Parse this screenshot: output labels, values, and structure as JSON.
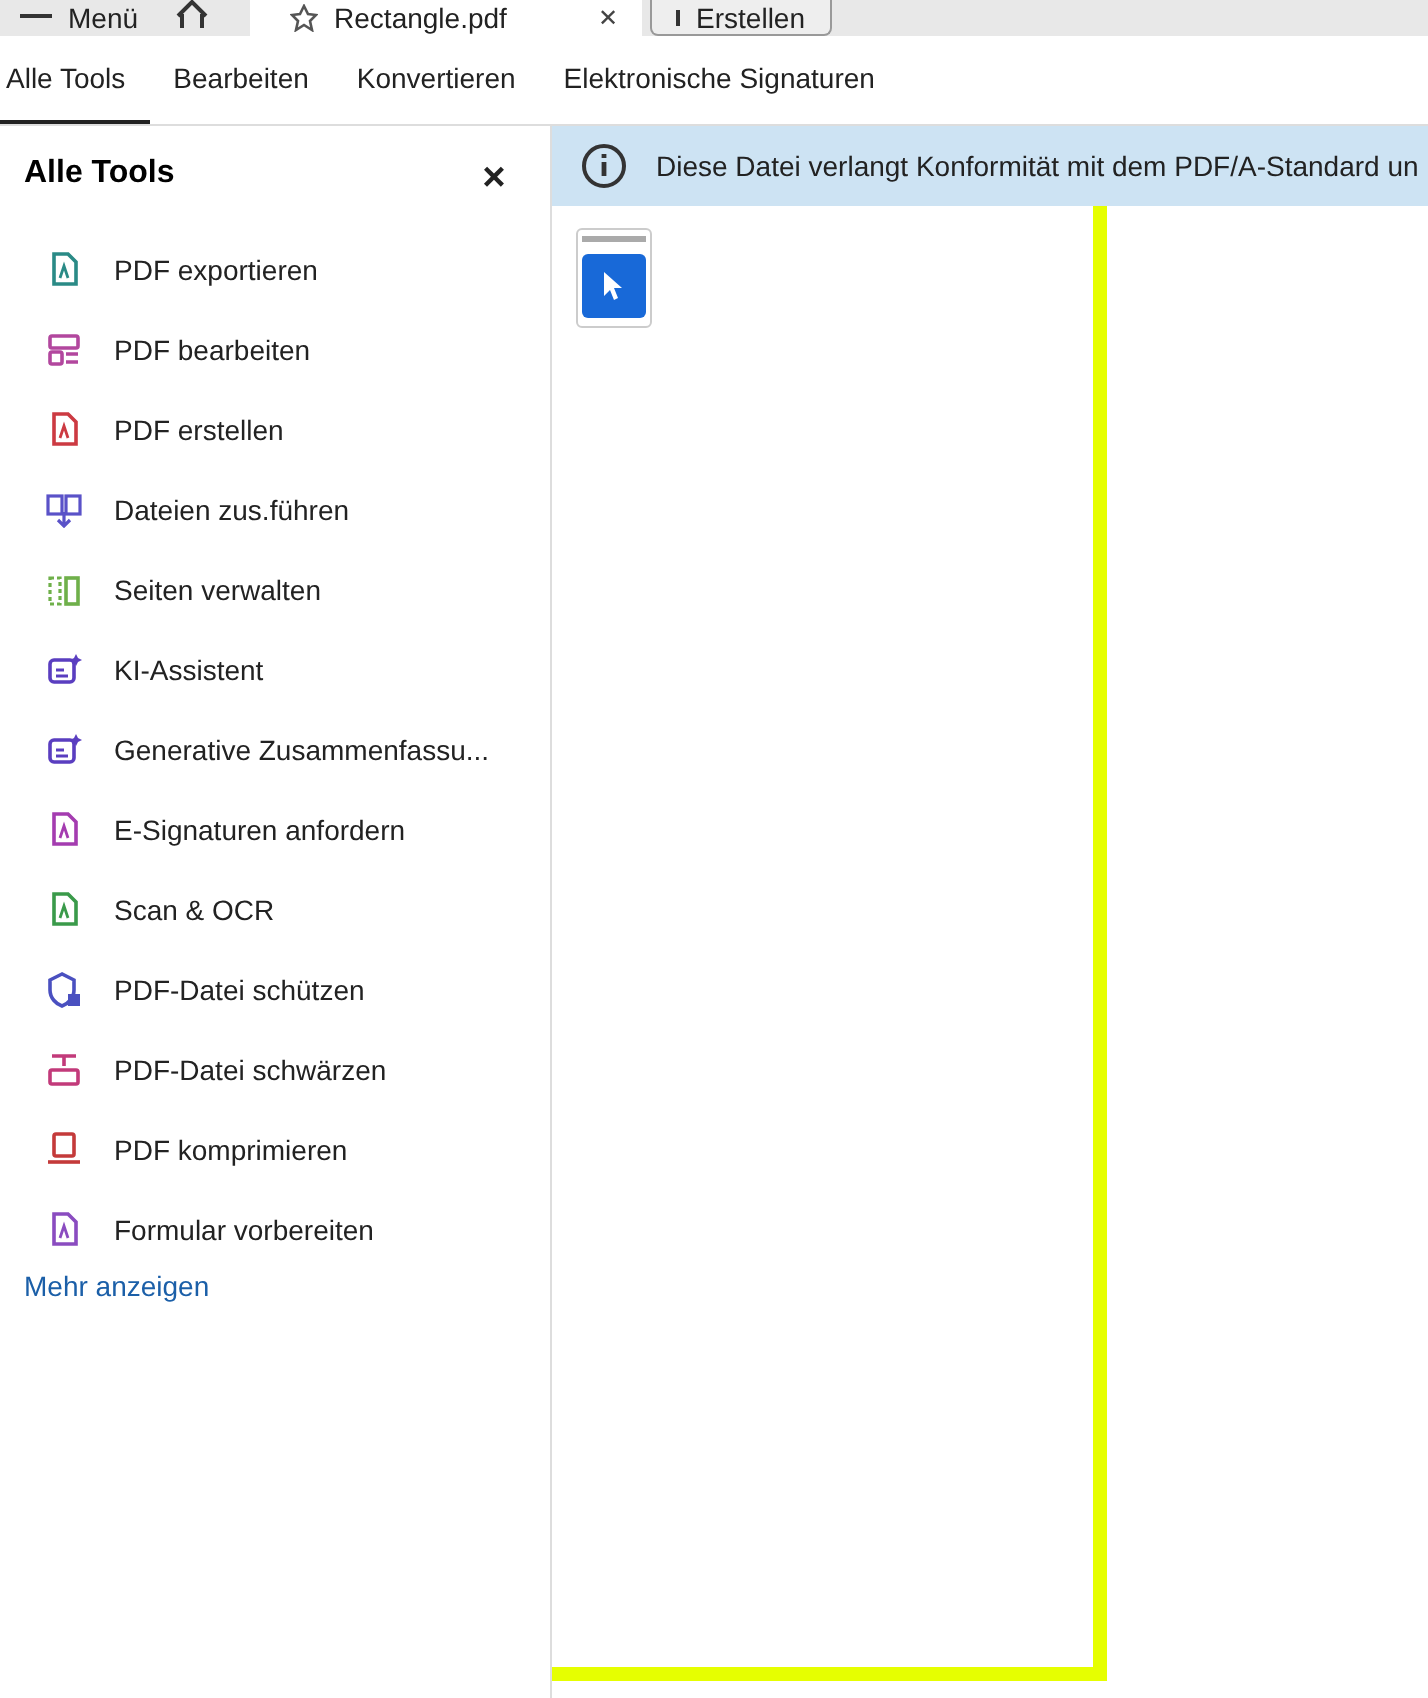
{
  "app_tabs": [
    {
      "label": "Menü",
      "kind": "menu",
      "selected": false
    },
    {
      "kind": "home",
      "selected": false
    },
    {
      "label": "Rectangle.pdf",
      "kind": "file",
      "selected": true,
      "close": "✕"
    },
    {
      "label": "Erstellen",
      "kind": "create",
      "selected": false
    }
  ],
  "nav_tabs": [
    {
      "label": "Alle Tools",
      "selected": true
    },
    {
      "label": "Bearbeiten",
      "selected": false
    },
    {
      "label": "Konvertieren",
      "selected": false
    },
    {
      "label": "Elektronische Signaturen",
      "selected": false
    }
  ],
  "sidebar": {
    "title": "Alle Tools",
    "close": "×",
    "items": [
      {
        "label": "PDF exportieren",
        "color": "#2a8a86"
      },
      {
        "label": "PDF bearbeiten",
        "color": "#b2479e"
      },
      {
        "label": "PDF erstellen",
        "color": "#cc3a42"
      },
      {
        "label": "Dateien zus.führen",
        "color": "#5a52c8"
      },
      {
        "label": "Seiten verwalten",
        "color": "#6fb04a"
      },
      {
        "label": "KI-Assistent",
        "color": "#5a3ec0"
      },
      {
        "label": "Generative Zusammenfassu...",
        "color": "#5a3ec0"
      },
      {
        "label": "E-Signaturen anfordern",
        "color": "#a43cb0"
      },
      {
        "label": "Scan & OCR",
        "color": "#3a9a4a"
      },
      {
        "label": "PDF-Datei schützen",
        "color": "#4a50c0"
      },
      {
        "label": "PDF-Datei schwärzen",
        "color": "#c23a7a"
      },
      {
        "label": "PDF komprimieren",
        "color": "#c43a3a"
      },
      {
        "label": "Formular vorbereiten",
        "color": "#8a4cc0"
      }
    ],
    "more_link": "Mehr anzeigen"
  },
  "banner": {
    "text": "Diese Datei verlangt Konformität mit dem PDF/A-Standard un"
  },
  "tool_palette": {
    "selected_tool_active": true
  }
}
